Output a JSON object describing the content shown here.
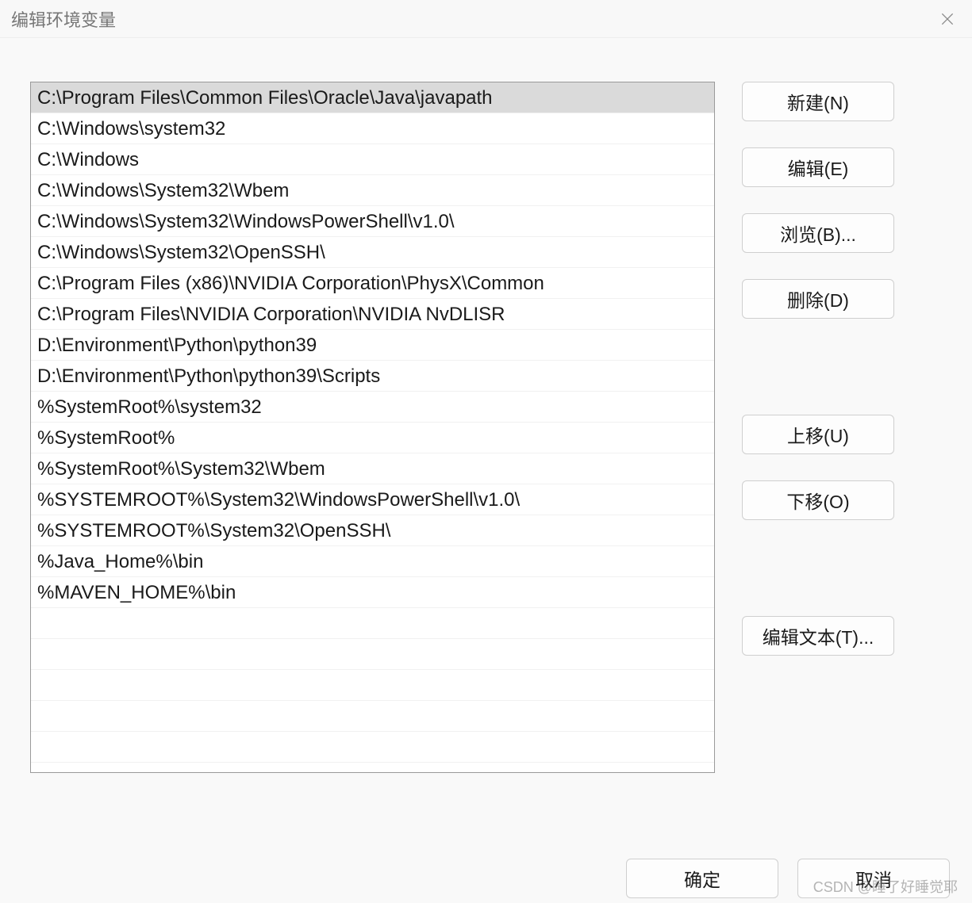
{
  "title": "编辑环境变量",
  "entries": [
    "C:\\Program Files\\Common Files\\Oracle\\Java\\javapath",
    "C:\\Windows\\system32",
    "C:\\Windows",
    "C:\\Windows\\System32\\Wbem",
    "C:\\Windows\\System32\\WindowsPowerShell\\v1.0\\",
    "C:\\Windows\\System32\\OpenSSH\\",
    "C:\\Program Files (x86)\\NVIDIA Corporation\\PhysX\\Common",
    "C:\\Program Files\\NVIDIA Corporation\\NVIDIA NvDLISR",
    "D:\\Environment\\Python\\python39",
    "D:\\Environment\\Python\\python39\\Scripts",
    "%SystemRoot%\\system32",
    "%SystemRoot%",
    "%SystemRoot%\\System32\\Wbem",
    "%SYSTEMROOT%\\System32\\WindowsPowerShell\\v1.0\\",
    "%SYSTEMROOT%\\System32\\OpenSSH\\",
    "%Java_Home%\\bin",
    "%MAVEN_HOME%\\bin"
  ],
  "selected_index": 0,
  "visible_rows": 22,
  "buttons": {
    "new": "新建(N)",
    "edit": "编辑(E)",
    "browse": "浏览(B)...",
    "delete": "删除(D)",
    "moveup": "上移(U)",
    "movedown": "下移(O)",
    "edittext": "编辑文本(T)...",
    "ok": "确定",
    "cancel": "取消"
  },
  "watermark": "CSDN @睡了好睡觉耶"
}
